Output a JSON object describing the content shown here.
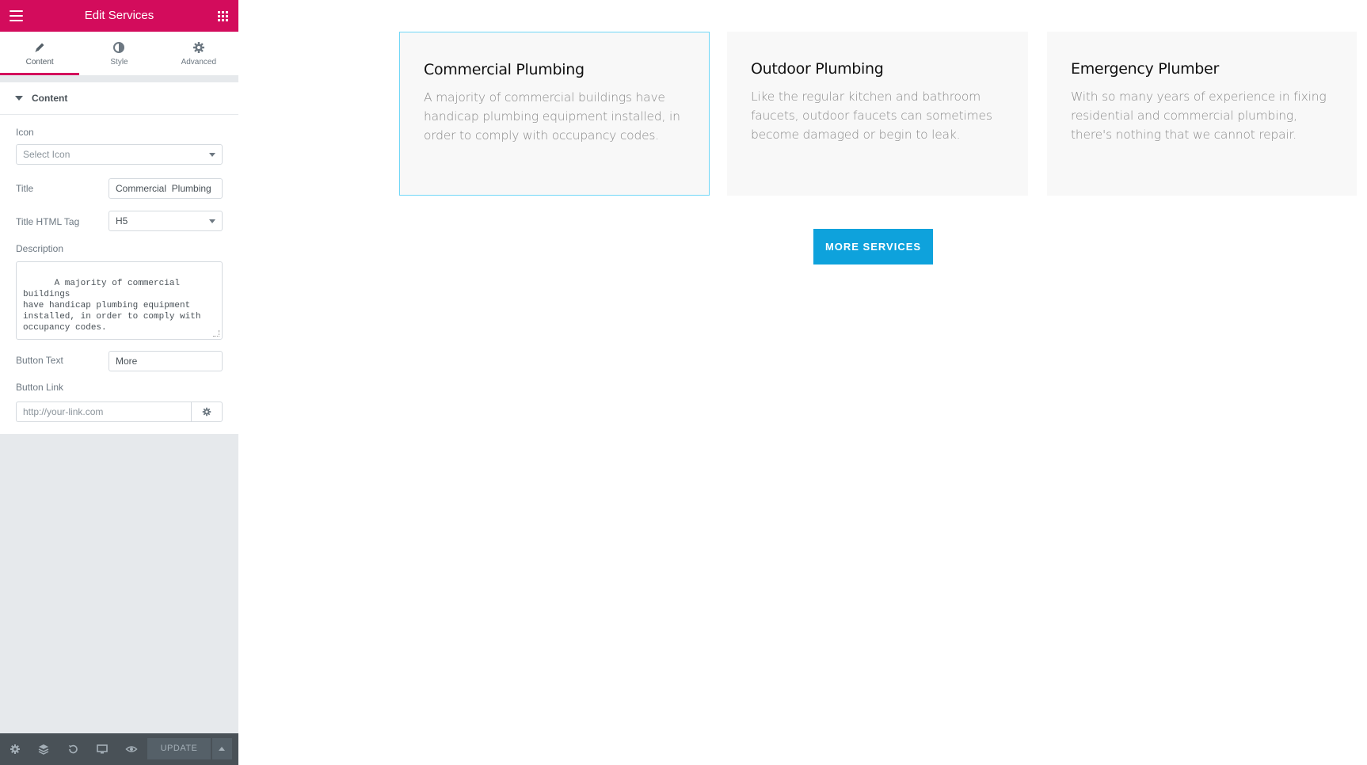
{
  "header": {
    "title": "Edit Services"
  },
  "tabs": [
    {
      "label": "Content",
      "icon": "pencil-icon"
    },
    {
      "label": "Style",
      "icon": "contrast-icon"
    },
    {
      "label": "Advanced",
      "icon": "gear-icon"
    }
  ],
  "section": {
    "label": "Content"
  },
  "fields": {
    "icon_label": "Icon",
    "icon_placeholder": "Select Icon",
    "title_label": "Title",
    "title_value": "Commercial  Plumbing",
    "tag_label": "Title HTML Tag",
    "tag_value": "H5",
    "description_label": "Description",
    "description_value": "A majority of commercial buildings\nhave handicap plumbing equipment\ninstalled, in order to comply with\noccupancy codes.",
    "button_text_label": "Button Text",
    "button_text_value": "More",
    "button_link_label": "Button Link",
    "button_link_placeholder": "http://your-link.com"
  },
  "footer": {
    "update_label": "UPDATE"
  },
  "colors": {
    "brand": "#d30c5c",
    "accent": "#0ea2dc",
    "card_bg": "#f8f8f8",
    "selected_border": "#71d7f7"
  },
  "cards": [
    {
      "title": "Commercial Plumbing",
      "description": "A majority of commercial buildings have handicap plumbing equipment installed, in order to comply with occupancy codes."
    },
    {
      "title": "Outdoor Plumbing",
      "description": "Like the regular kitchen and bathroom faucets, outdoor faucets can sometimes become damaged or begin to leak."
    },
    {
      "title": "Emergency Plumber",
      "description": "With so many years of experience in fixing residential and commercial plumbing, there's nothing that we cannot repair."
    }
  ],
  "cta": {
    "label": "MORE SERVICES"
  }
}
